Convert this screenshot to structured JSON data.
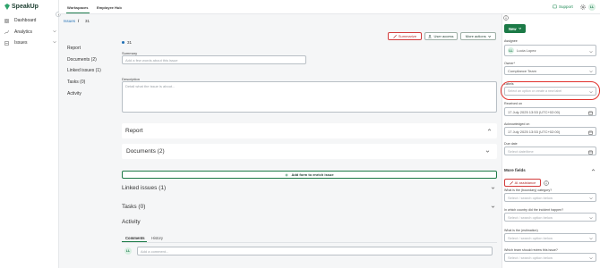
{
  "app": {
    "logo_text": "SpeakUp"
  },
  "sidebar": {
    "items": [
      {
        "label": "Dashboard",
        "icon": "dashboard-icon"
      },
      {
        "label": "Analytics",
        "icon": "analytics-icon"
      },
      {
        "label": "Issues",
        "icon": "issues-icon"
      }
    ]
  },
  "topbar": {
    "tabs": [
      "Workspaces",
      "Employee Hub"
    ],
    "support_label": "Support",
    "avatar_initials": "LL"
  },
  "breadcrumb": {
    "root": "Issues",
    "sep": "/",
    "id": "31"
  },
  "issue_nav": {
    "links": [
      "Report",
      "Documents (2)",
      "Linked issues (1)",
      "Tasks (0)",
      "Activity"
    ]
  },
  "actions": {
    "summarize": "Summarize",
    "user_access": "User access",
    "more_actions": "More actions"
  },
  "main": {
    "issue_id": "31",
    "summary_label": "Summary",
    "summary_placeholder": "Add a few words about this issue",
    "description_label": "Description",
    "description_placeholder": "Detail what the issue is about...",
    "report_title": "Report",
    "documents_title": "Documents (2)",
    "add_form_label": "Add form to enrich issue",
    "linked_title": "Linked issues (1)",
    "tasks_title": "Tasks (0)",
    "activity_title": "Activity",
    "activity_tabs": [
      "Comments",
      "History"
    ],
    "comment_placeholder": "Add a comment...",
    "comment_avatar": "LL"
  },
  "right_panel": {
    "new_label": "New",
    "assignee_label": "Assignee",
    "assignee_initials": "LL",
    "assignee_value": "Lucia Lopez",
    "owner_label": "Owner*",
    "owner_value": "Compliance Team",
    "labels_label": "Labels",
    "labels_placeholder": "Select an option or create a new label",
    "received_label": "Received on",
    "received_value": "17 July 2025 13:53 (UTC+02:00)",
    "ack_label": "Acknowledged on",
    "ack_value": "17 July 2025 13:53 (UTC+02:00)",
    "due_label": "Due date",
    "due_placeholder": "Select date/time",
    "more_fields": "More fields",
    "ai_assistance": "AI assistance",
    "q1_label": "What is the (boundary) category?",
    "q1_placeholder": "Select / search option below",
    "q2_label": "In which country did the incident happen?",
    "q2_placeholder": "Select / search option below",
    "q3_label": "What is the (estimation)",
    "q3_placeholder": "Select / search option below",
    "q4_label": "Which team should review this issue?",
    "q4_placeholder": "Select / search option below"
  },
  "colors": {
    "brand": "#1c7a47",
    "link": "#1f6fb5",
    "highlight": "#e0312c"
  }
}
